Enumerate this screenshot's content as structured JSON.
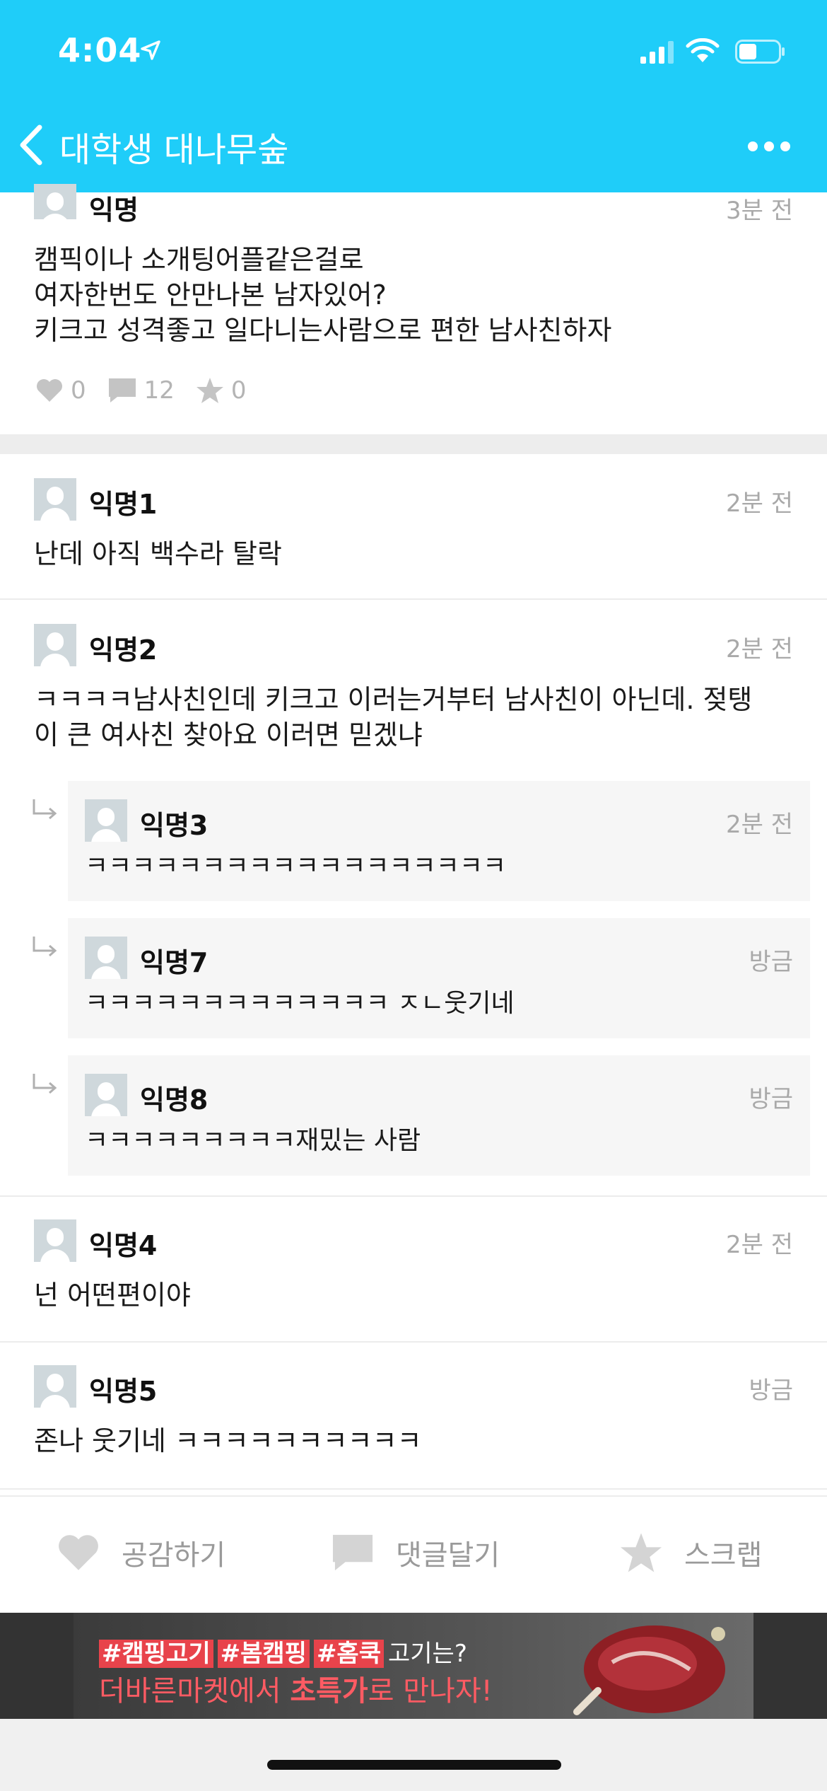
{
  "status_bar": {
    "time": "4:04"
  },
  "header": {
    "title": "대학생 대나무숲"
  },
  "post": {
    "author": "익명",
    "time": "3분 전",
    "lines": [
      "캠픽이나 소개팅어플같은걸로",
      "여자한번도 안만나본 남자있어?",
      "키크고 성격좋고 일다니는사람으로 편한 남사친하자"
    ],
    "likes": "0",
    "comments": "12",
    "scraps": "0"
  },
  "comments": [
    {
      "author": "익명1",
      "time": "2분 전",
      "text": "난데 아직 백수라 탈락"
    },
    {
      "author": "익명2",
      "time": "2분 전",
      "text_lines": [
        "ㅋㅋㅋㅋ남사친인데 키크고 이러는거부터 남사친이 아닌데. 젖탱",
        "이 큰 여사친 찾아요 이러면 믿겠냐"
      ]
    },
    {
      "author": "익명4",
      "time": "2분 전",
      "text": "넌 어떤편이야"
    },
    {
      "author": "익명5",
      "time": "방금",
      "text": "존나 웃기네 ㅋㅋㅋㅋㅋㅋㅋㅋㅋㅋ"
    }
  ],
  "replies": [
    {
      "author": "익명3",
      "time": "2분 전",
      "text": "ㅋㅋㅋㅋㅋㅋㅋㅋㅋㅋㅋㅋㅋㅋㅋㅋㅋㅋ"
    },
    {
      "author": "익명7",
      "time": "방금",
      "text": "ㅋㅋㅋㅋㅋㅋㅋㅋㅋㅋㅋㅋㅋ ㅈㄴ웃기네"
    },
    {
      "author": "익명8",
      "time": "방금",
      "text": "ㅋㅋㅋㅋㅋㅋㅋㅋㅋ재밌는 사람"
    }
  ],
  "actions": {
    "like": "공감하기",
    "comment": "댓글달기",
    "scrap": "스크랩"
  },
  "ad": {
    "tag1": "#캠핑고기",
    "tag2": "#봄캠핑",
    "tag3": "#홈쿡",
    "line1_suffix": "고기는?",
    "line2_a": "더바른마켓에서 ",
    "line2_b": "초특가",
    "line2_c": "로 만나자!"
  },
  "colors": {
    "header": "#1fcdf9",
    "muted": "#a9a9a9",
    "reply_bg": "#f6f6f6"
  }
}
